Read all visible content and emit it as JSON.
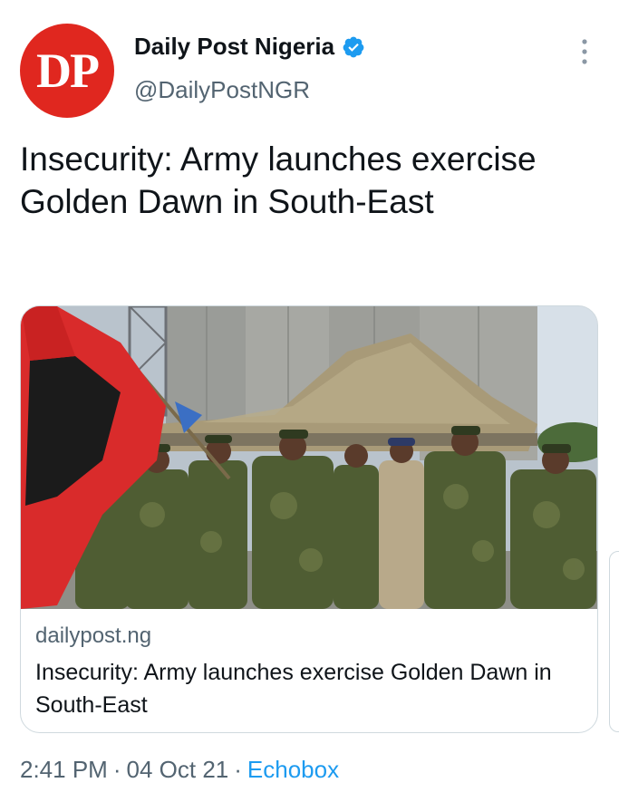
{
  "author": {
    "avatar_text": "DP",
    "display_name": "Daily Post Nigeria",
    "handle": "@DailyPostNGR"
  },
  "tweet": {
    "text": "Insecurity: Army launches exercise Golden Dawn in South-East"
  },
  "card": {
    "domain": "dailypost.ng",
    "title": "Insecurity: Army launches exercise Golden Dawn in South-East"
  },
  "meta": {
    "time": "2:41 PM",
    "separator": "·",
    "date": "04 Oct 21",
    "source": "Echobox"
  },
  "colors": {
    "avatar": "#e0271f",
    "verified": "#1d9bf0",
    "secondary_text": "#536471",
    "link": "#1d9bf0"
  }
}
